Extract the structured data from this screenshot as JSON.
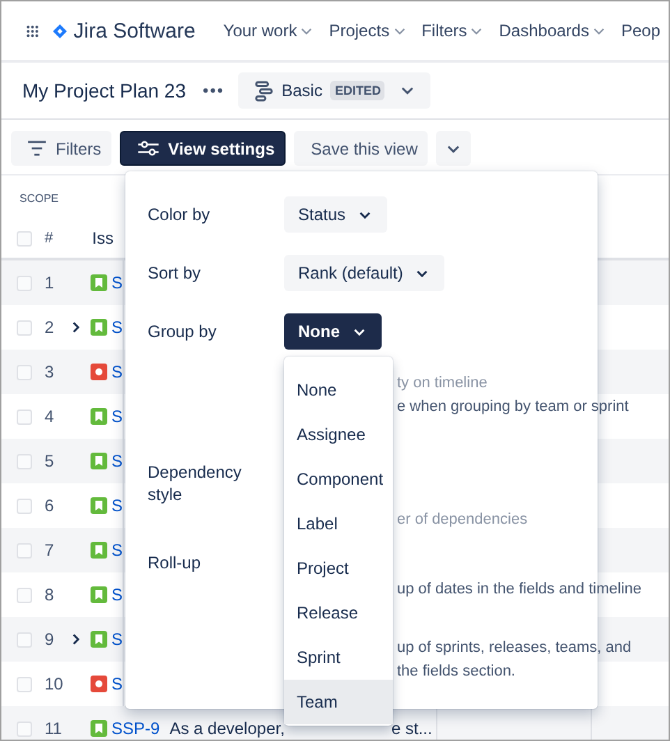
{
  "nav": {
    "product": "Jira Software",
    "items": [
      {
        "label": "Your work",
        "menu": true
      },
      {
        "label": "Projects",
        "menu": true
      },
      {
        "label": "Filters",
        "menu": true
      },
      {
        "label": "Dashboards",
        "menu": true
      },
      {
        "label": "Peop",
        "menu": false
      }
    ]
  },
  "plan": {
    "title": "My Project Plan 23",
    "more": "•••",
    "view": {
      "name": "Basic",
      "badge": "EDITED"
    }
  },
  "toolbar": [
    {
      "kind": "filters",
      "label": "Filters",
      "selected": false
    },
    {
      "kind": "settings",
      "label": "View settings",
      "selected": true
    },
    {
      "kind": "plain",
      "label": "Save this view",
      "selected": false
    },
    {
      "kind": "more",
      "selected": false
    }
  ],
  "table": {
    "scope": "SCOPE",
    "select_all_checked": false,
    "columns": [
      "#",
      "Iss"
    ],
    "rows": [
      {
        "checked": false,
        "number": "1",
        "kind": "story",
        "expandable": false,
        "key": "S"
      },
      {
        "checked": false,
        "number": "2",
        "kind": "story",
        "expandable": true,
        "key": "S"
      },
      {
        "checked": false,
        "number": "3",
        "kind": "bug",
        "expandable": false,
        "key": "S"
      },
      {
        "checked": false,
        "number": "4",
        "kind": "story",
        "expandable": false,
        "key": "S"
      },
      {
        "checked": false,
        "number": "5",
        "kind": "story",
        "expandable": false,
        "key": "S"
      },
      {
        "checked": false,
        "number": "6",
        "kind": "story",
        "expandable": false,
        "key": "S"
      },
      {
        "checked": false,
        "number": "7",
        "kind": "story",
        "expandable": false,
        "key": "S"
      },
      {
        "checked": false,
        "number": "8",
        "kind": "story",
        "expandable": false,
        "key": "S"
      },
      {
        "checked": false,
        "number": "9",
        "kind": "story",
        "expandable": true,
        "key": "S"
      },
      {
        "checked": false,
        "number": "10",
        "kind": "bug",
        "expandable": false,
        "key": "S"
      },
      {
        "checked": false,
        "number": "11",
        "kind": "story",
        "expandable": false,
        "key": "SSP-9",
        "summary_start": "As a developer,",
        "summary_end": "e st..."
      }
    ]
  },
  "view_settings": {
    "selects": [
      {
        "label": "Color by",
        "value": "Status",
        "open": false
      },
      {
        "label": "Sort by",
        "value": "Rank (default)",
        "open": false
      },
      {
        "label": "Group by",
        "value": "None",
        "open": true
      }
    ],
    "sections": [
      {
        "fragments": [
          {
            "text": "ty on timeline",
            "muted": true
          },
          {
            "text": "e when grouping by team or sprint",
            "muted": false
          }
        ]
      },
      {
        "label": "Dependency style",
        "fragments": [
          {
            "text": "er of dependencies",
            "muted": true
          }
        ]
      },
      {
        "label": "Roll-up",
        "fragments": [
          {
            "text": "up of dates in the fields and timeline",
            "muted": false
          }
        ]
      },
      {
        "fragments": [
          {
            "text": "up of sprints, releases, teams, and",
            "muted": false
          },
          {
            "text": "the fields section.",
            "muted": false
          }
        ]
      }
    ],
    "group_menu": [
      {
        "label": "None",
        "highlighted": false
      },
      {
        "label": "Assignee",
        "highlighted": false
      },
      {
        "label": "Component",
        "highlighted": false
      },
      {
        "label": "Label",
        "highlighted": false
      },
      {
        "label": "Project",
        "highlighted": false
      },
      {
        "label": "Release",
        "highlighted": false
      },
      {
        "label": "Sprint",
        "highlighted": false
      },
      {
        "label": "Team",
        "highlighted": true
      }
    ]
  }
}
